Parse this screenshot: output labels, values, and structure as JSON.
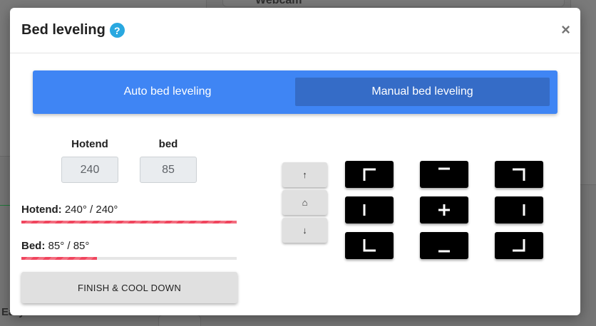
{
  "background": {
    "card_title": "Webcam",
    "bottom_text": "Eary"
  },
  "modal": {
    "title": "Bed leveling",
    "help_icon": "question-circle-icon",
    "close_label": "×"
  },
  "tabs": [
    {
      "label": "Auto bed leveling",
      "active": false
    },
    {
      "label": "Manual bed leveling",
      "active": true
    }
  ],
  "temps": {
    "hotend_label": "Hotend",
    "bed_label": "bed",
    "hotend_value": "240",
    "bed_value": "85"
  },
  "status": {
    "hotend_label": "Hotend:",
    "hotend_value": "240° / 240°",
    "hotend_progress": 1.0,
    "bed_label": "Bed:",
    "bed_value": "85° / 85°",
    "bed_progress": 0.35
  },
  "finish_button": "FINISH & COOL DOWN",
  "z_controls": {
    "up": "↑",
    "home": "⌂",
    "down": "↓"
  },
  "level_points": [
    "top-left-corner-icon",
    "top-edge-icon",
    "top-right-corner-icon",
    "left-edge-icon",
    "center-plus-icon",
    "right-edge-icon",
    "bottom-left-corner-icon",
    "bottom-edge-icon",
    "bottom-right-corner-icon"
  ],
  "colors": {
    "tab_bar": "#3f85f4",
    "tab_active": "#356cc7",
    "progress": "#f0455e",
    "help": "#29a8e0"
  }
}
